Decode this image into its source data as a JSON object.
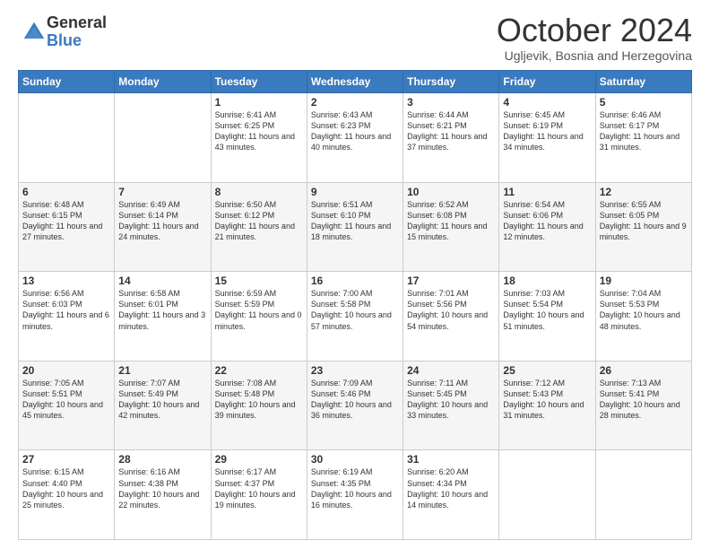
{
  "logo": {
    "line1": "General",
    "line2": "Blue"
  },
  "header": {
    "month": "October 2024",
    "location": "Ugljevik, Bosnia and Herzegovina"
  },
  "weekdays": [
    "Sunday",
    "Monday",
    "Tuesday",
    "Wednesday",
    "Thursday",
    "Friday",
    "Saturday"
  ],
  "weeks": [
    [
      {
        "day": "",
        "info": ""
      },
      {
        "day": "",
        "info": ""
      },
      {
        "day": "1",
        "info": "Sunrise: 6:41 AM\nSunset: 6:25 PM\nDaylight: 11 hours and 43 minutes."
      },
      {
        "day": "2",
        "info": "Sunrise: 6:43 AM\nSunset: 6:23 PM\nDaylight: 11 hours and 40 minutes."
      },
      {
        "day": "3",
        "info": "Sunrise: 6:44 AM\nSunset: 6:21 PM\nDaylight: 11 hours and 37 minutes."
      },
      {
        "day": "4",
        "info": "Sunrise: 6:45 AM\nSunset: 6:19 PM\nDaylight: 11 hours and 34 minutes."
      },
      {
        "day": "5",
        "info": "Sunrise: 6:46 AM\nSunset: 6:17 PM\nDaylight: 11 hours and 31 minutes."
      }
    ],
    [
      {
        "day": "6",
        "info": "Sunrise: 6:48 AM\nSunset: 6:15 PM\nDaylight: 11 hours and 27 minutes."
      },
      {
        "day": "7",
        "info": "Sunrise: 6:49 AM\nSunset: 6:14 PM\nDaylight: 11 hours and 24 minutes."
      },
      {
        "day": "8",
        "info": "Sunrise: 6:50 AM\nSunset: 6:12 PM\nDaylight: 11 hours and 21 minutes."
      },
      {
        "day": "9",
        "info": "Sunrise: 6:51 AM\nSunset: 6:10 PM\nDaylight: 11 hours and 18 minutes."
      },
      {
        "day": "10",
        "info": "Sunrise: 6:52 AM\nSunset: 6:08 PM\nDaylight: 11 hours and 15 minutes."
      },
      {
        "day": "11",
        "info": "Sunrise: 6:54 AM\nSunset: 6:06 PM\nDaylight: 11 hours and 12 minutes."
      },
      {
        "day": "12",
        "info": "Sunrise: 6:55 AM\nSunset: 6:05 PM\nDaylight: 11 hours and 9 minutes."
      }
    ],
    [
      {
        "day": "13",
        "info": "Sunrise: 6:56 AM\nSunset: 6:03 PM\nDaylight: 11 hours and 6 minutes."
      },
      {
        "day": "14",
        "info": "Sunrise: 6:58 AM\nSunset: 6:01 PM\nDaylight: 11 hours and 3 minutes."
      },
      {
        "day": "15",
        "info": "Sunrise: 6:59 AM\nSunset: 5:59 PM\nDaylight: 11 hours and 0 minutes."
      },
      {
        "day": "16",
        "info": "Sunrise: 7:00 AM\nSunset: 5:58 PM\nDaylight: 10 hours and 57 minutes."
      },
      {
        "day": "17",
        "info": "Sunrise: 7:01 AM\nSunset: 5:56 PM\nDaylight: 10 hours and 54 minutes."
      },
      {
        "day": "18",
        "info": "Sunrise: 7:03 AM\nSunset: 5:54 PM\nDaylight: 10 hours and 51 minutes."
      },
      {
        "day": "19",
        "info": "Sunrise: 7:04 AM\nSunset: 5:53 PM\nDaylight: 10 hours and 48 minutes."
      }
    ],
    [
      {
        "day": "20",
        "info": "Sunrise: 7:05 AM\nSunset: 5:51 PM\nDaylight: 10 hours and 45 minutes."
      },
      {
        "day": "21",
        "info": "Sunrise: 7:07 AM\nSunset: 5:49 PM\nDaylight: 10 hours and 42 minutes."
      },
      {
        "day": "22",
        "info": "Sunrise: 7:08 AM\nSunset: 5:48 PM\nDaylight: 10 hours and 39 minutes."
      },
      {
        "day": "23",
        "info": "Sunrise: 7:09 AM\nSunset: 5:46 PM\nDaylight: 10 hours and 36 minutes."
      },
      {
        "day": "24",
        "info": "Sunrise: 7:11 AM\nSunset: 5:45 PM\nDaylight: 10 hours and 33 minutes."
      },
      {
        "day": "25",
        "info": "Sunrise: 7:12 AM\nSunset: 5:43 PM\nDaylight: 10 hours and 31 minutes."
      },
      {
        "day": "26",
        "info": "Sunrise: 7:13 AM\nSunset: 5:41 PM\nDaylight: 10 hours and 28 minutes."
      }
    ],
    [
      {
        "day": "27",
        "info": "Sunrise: 6:15 AM\nSunset: 4:40 PM\nDaylight: 10 hours and 25 minutes."
      },
      {
        "day": "28",
        "info": "Sunrise: 6:16 AM\nSunset: 4:38 PM\nDaylight: 10 hours and 22 minutes."
      },
      {
        "day": "29",
        "info": "Sunrise: 6:17 AM\nSunset: 4:37 PM\nDaylight: 10 hours and 19 minutes."
      },
      {
        "day": "30",
        "info": "Sunrise: 6:19 AM\nSunset: 4:35 PM\nDaylight: 10 hours and 16 minutes."
      },
      {
        "day": "31",
        "info": "Sunrise: 6:20 AM\nSunset: 4:34 PM\nDaylight: 10 hours and 14 minutes."
      },
      {
        "day": "",
        "info": ""
      },
      {
        "day": "",
        "info": ""
      }
    ]
  ]
}
